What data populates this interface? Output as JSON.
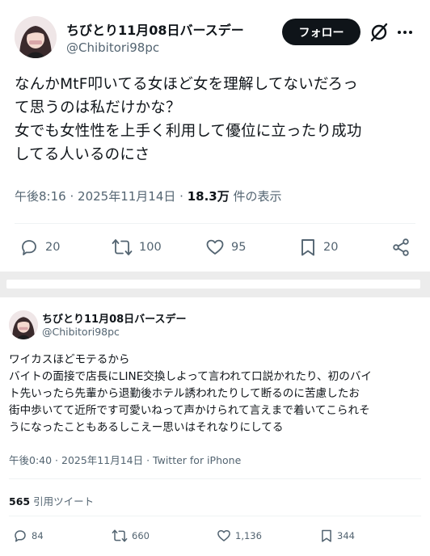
{
  "tweet1": {
    "display_name": "ちびとり11月08日バースデー",
    "handle": "@Chibitori98pc",
    "follow_label": "フォロー",
    "text_lines": [
      "なんかMtF叩いてる女ほど女を理解してないだろっ",
      "て思うのは私だけかな？",
      "女でも女性性を上手く利用して優位に立ったり成功",
      "してる人いるのにさ"
    ],
    "time": "午後8:16",
    "sep": "·",
    "date": "2025年11月14日",
    "views_count": "18.3万",
    "views_label": "件の表示",
    "actions": {
      "replies": "20",
      "reposts": "100",
      "likes": "95",
      "bookmarks": "20"
    }
  },
  "tweet2": {
    "display_name": "ちびとり11月08日バースデー",
    "handle": "@Chibitori98pc",
    "text_lines": [
      "ワイカスほどモテるから",
      "バイトの面接で店長にLINE交換しよって言われて口説かれたり、初のバイ",
      "ト先いったら先輩から退勤後ホテル誘われたりして断るのに苦慮したお",
      "街中歩いてて近所です可愛いねって声かけられて言えまで着いてこられそ",
      "うになったこともあるしこえー思いはそれなりにしてる"
    ],
    "meta": "午後0:40 · 2025年11月14日 · Twitter for iPhone",
    "quote_count": "565",
    "quote_label": "引用ツイート",
    "actions": {
      "replies": "84",
      "reposts": "660",
      "likes": "1,136",
      "bookmarks": "344"
    }
  },
  "icons": {
    "reply": "speech-bubble-icon",
    "repost": "repost-arrows-icon",
    "like": "heart-icon",
    "bookmark": "bookmark-icon",
    "share": "share-icon",
    "grok": "grok-icon",
    "more": "more-dots-icon"
  },
  "colors": {
    "text": "#0f1419",
    "secondary": "#536471",
    "divider": "#eff3f4",
    "follow_bg": "#0f1419"
  }
}
